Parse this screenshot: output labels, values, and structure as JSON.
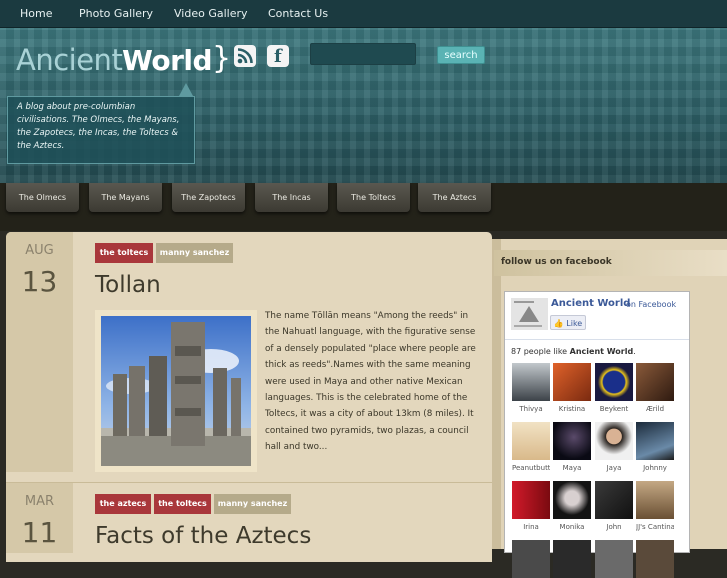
{
  "nav": {
    "items": [
      "Home",
      "Photo Gallery",
      "Video Gallery",
      "Contact Us"
    ]
  },
  "header": {
    "logo_light": "Ancient",
    "logo_bold": "World",
    "brace": "}",
    "search_button": "search",
    "search_placeholder": "",
    "tagline": "A blog about pre-columbian civilisations. The Olmecs, the Mayans, the Zapotecs, the Incas, the Toltecs & the Aztecs."
  },
  "categories": [
    "The Olmecs",
    "The Mayans",
    "The Zapotecs",
    "The Incas",
    "The Toltecs",
    "The Aztecs"
  ],
  "posts": [
    {
      "month": "AUG",
      "day": "13",
      "tags": [
        "the toltecs",
        "manny sanchez"
      ],
      "title": "Tollan",
      "excerpt": "The name Tōllān means \"Among the reeds\" in the Nahuatl  language, with the figurative sense of a densely populated \"place where people are thick as reeds\".Names with the same meaning were used in Maya and other native Mexican languages. This is the celebrated home of the Toltecs, it was a city of about 13km (8 miles). It contained two pyramids, two plazas, a council hall and two..."
    },
    {
      "month": "MAR",
      "day": "11",
      "tags": [
        "the aztecs",
        "the toltecs",
        "manny sanchez"
      ],
      "title": "Facts of the Aztecs"
    }
  ],
  "sidebar": {
    "heading": "follow us on facebook",
    "fb": {
      "page_name": "Ancient World",
      "on_facebook": "on Facebook",
      "like_label": "Like",
      "count_prefix": "87 people like ",
      "count_page": "Ancient World",
      "count_suffix": ".",
      "fans": [
        "Thivya",
        "Kristina",
        "Beykent",
        "Ærild",
        "Peanutbutte",
        "Maya",
        "Jaya",
        "Johnny",
        "Irina",
        "Monika",
        "John",
        "JJ's Cantina"
      ]
    }
  },
  "colors": {
    "brand_teal": "#2d5f66",
    "tag_red": "#a9373b",
    "fb_blue": "#3b5998"
  }
}
